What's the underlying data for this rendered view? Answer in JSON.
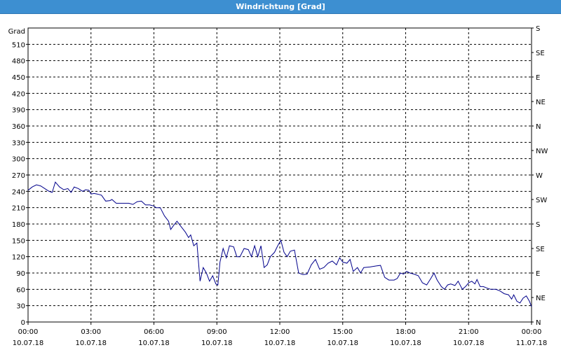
{
  "window": {
    "title": "Windrichtung [Grad]"
  },
  "chart_data": {
    "type": "line",
    "title": "Windrichtung [Grad]",
    "ylabel": "Grad",
    "ylim": [
      0,
      540
    ],
    "y_ticks": [
      0,
      30,
      60,
      90,
      120,
      150,
      180,
      210,
      240,
      270,
      300,
      330,
      360,
      390,
      420,
      450,
      480,
      510
    ],
    "right_axis_labels": [
      "N",
      "NE",
      "E",
      "SE",
      "S",
      "SW",
      "W",
      "NW",
      "N",
      "NE",
      "E",
      "SE",
      "S"
    ],
    "x_ticks": [
      {
        "time": "00:00",
        "date": "10.07.18"
      },
      {
        "time": "03:00",
        "date": "10.07.18"
      },
      {
        "time": "06:00",
        "date": "10.07.18"
      },
      {
        "time": "09:00",
        "date": "10.07.18"
      },
      {
        "time": "12:00",
        "date": "10.07.18"
      },
      {
        "time": "15:00",
        "date": "10.07.18"
      },
      {
        "time": "18:00",
        "date": "10.07.18"
      },
      {
        "time": "21:00",
        "date": "10.07.18"
      },
      {
        "time": "00:00",
        "date": "11.07.18"
      }
    ],
    "x_range_hours": [
      0,
      24
    ],
    "grid": true,
    "line_color": "#00008b",
    "series": [
      {
        "values": [
          [
            0.0,
            242
          ],
          [
            0.2,
            248
          ],
          [
            0.4,
            252
          ],
          [
            0.6,
            250
          ],
          [
            0.8,
            245
          ],
          [
            1.0,
            240
          ],
          [
            1.15,
            238
          ],
          [
            1.3,
            257
          ],
          [
            1.5,
            248
          ],
          [
            1.7,
            243
          ],
          [
            1.9,
            245
          ],
          [
            2.05,
            238
          ],
          [
            2.2,
            248
          ],
          [
            2.4,
            245
          ],
          [
            2.6,
            240
          ],
          [
            2.75,
            243
          ],
          [
            2.9,
            242
          ],
          [
            3.0,
            235
          ],
          [
            3.15,
            236
          ],
          [
            3.3,
            235
          ],
          [
            3.5,
            233
          ],
          [
            3.7,
            222
          ],
          [
            3.9,
            223
          ],
          [
            4.0,
            225
          ],
          [
            4.2,
            218
          ],
          [
            4.5,
            218
          ],
          [
            4.8,
            218
          ],
          [
            5.0,
            216
          ],
          [
            5.2,
            221
          ],
          [
            5.4,
            222
          ],
          [
            5.6,
            215
          ],
          [
            5.8,
            215
          ],
          [
            6.0,
            213
          ],
          [
            6.1,
            210
          ],
          [
            6.3,
            210
          ],
          [
            6.5,
            195
          ],
          [
            6.7,
            185
          ],
          [
            6.8,
            170
          ],
          [
            6.95,
            178
          ],
          [
            7.1,
            185
          ],
          [
            7.3,
            175
          ],
          [
            7.5,
            165
          ],
          [
            7.65,
            155
          ],
          [
            7.75,
            160
          ],
          [
            7.9,
            140
          ],
          [
            8.05,
            145
          ],
          [
            8.2,
            75
          ],
          [
            8.35,
            100
          ],
          [
            8.5,
            90
          ],
          [
            8.65,
            75
          ],
          [
            8.8,
            85
          ],
          [
            8.95,
            70
          ],
          [
            9.05,
            68
          ],
          [
            9.15,
            110
          ],
          [
            9.3,
            135
          ],
          [
            9.45,
            118
          ],
          [
            9.6,
            140
          ],
          [
            9.8,
            138
          ],
          [
            9.95,
            120
          ],
          [
            10.1,
            120
          ],
          [
            10.3,
            135
          ],
          [
            10.5,
            133
          ],
          [
            10.65,
            120
          ],
          [
            10.8,
            140
          ],
          [
            10.95,
            120
          ],
          [
            11.1,
            140
          ],
          [
            11.25,
            100
          ],
          [
            11.4,
            105
          ],
          [
            11.55,
            120
          ],
          [
            11.75,
            128
          ],
          [
            11.9,
            140
          ],
          [
            12.05,
            150
          ],
          [
            12.2,
            128
          ],
          [
            12.35,
            120
          ],
          [
            12.5,
            130
          ],
          [
            12.7,
            132
          ],
          [
            12.9,
            90
          ],
          [
            13.1,
            87
          ],
          [
            13.3,
            88
          ],
          [
            13.5,
            105
          ],
          [
            13.7,
            115
          ],
          [
            13.9,
            97
          ],
          [
            14.1,
            100
          ],
          [
            14.3,
            108
          ],
          [
            14.5,
            112
          ],
          [
            14.7,
            105
          ],
          [
            14.85,
            118
          ],
          [
            15.0,
            110
          ],
          [
            15.2,
            108
          ],
          [
            15.35,
            115
          ],
          [
            15.5,
            93
          ],
          [
            15.7,
            100
          ],
          [
            15.85,
            90
          ],
          [
            16.0,
            100
          ],
          [
            16.3,
            101
          ],
          [
            16.6,
            103
          ],
          [
            16.8,
            104
          ],
          [
            17.0,
            82
          ],
          [
            17.2,
            77
          ],
          [
            17.45,
            77
          ],
          [
            17.6,
            80
          ],
          [
            17.75,
            90
          ],
          [
            17.9,
            88
          ],
          [
            18.05,
            93
          ],
          [
            18.2,
            90
          ],
          [
            18.4,
            88
          ],
          [
            18.6,
            85
          ],
          [
            18.8,
            72
          ],
          [
            19.0,
            68
          ],
          [
            19.2,
            80
          ],
          [
            19.35,
            90
          ],
          [
            19.5,
            77
          ],
          [
            19.7,
            65
          ],
          [
            19.85,
            60
          ],
          [
            20.0,
            68
          ],
          [
            20.15,
            70
          ],
          [
            20.35,
            67
          ],
          [
            20.5,
            75
          ],
          [
            20.7,
            60
          ],
          [
            20.85,
            65
          ],
          [
            21.0,
            72
          ],
          [
            21.15,
            75
          ],
          [
            21.3,
            70
          ],
          [
            21.4,
            78
          ],
          [
            21.55,
            65
          ],
          [
            21.7,
            65
          ],
          [
            21.9,
            62
          ],
          [
            22.05,
            60
          ],
          [
            22.3,
            60
          ],
          [
            22.5,
            57
          ],
          [
            22.7,
            52
          ],
          [
            22.9,
            50
          ],
          [
            23.05,
            42
          ],
          [
            23.15,
            50
          ],
          [
            23.3,
            38
          ],
          [
            23.45,
            35
          ],
          [
            23.6,
            44
          ],
          [
            23.75,
            48
          ],
          [
            23.9,
            38
          ],
          [
            24.0,
            28
          ]
        ]
      }
    ]
  }
}
